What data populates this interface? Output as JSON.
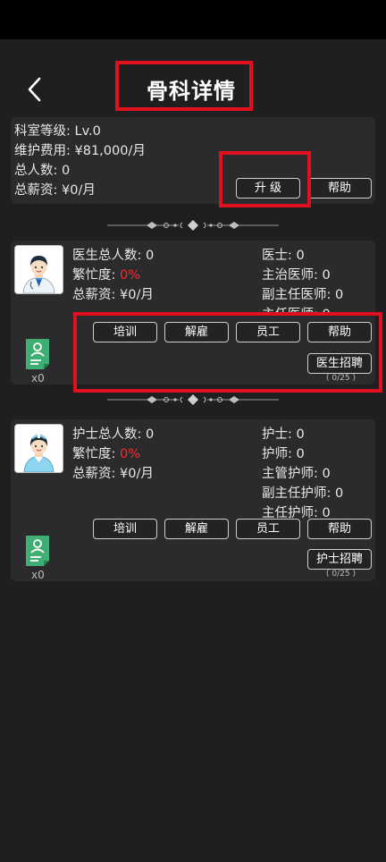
{
  "header": {
    "title": "骨科详情"
  },
  "summary": {
    "level": "科室等级: Lv.0",
    "maintenance": "维护费用: ¥81,000/月",
    "headcount": "总人数: 0",
    "salary": "总薪资: ¥0/月",
    "upgrade_label": "升 级",
    "help_label": "帮助"
  },
  "doctors": {
    "total": "医生总人数: 0",
    "busy_prefix": "繁忙度: ",
    "busy_value": "0%",
    "salary": "总薪资: ¥0/月",
    "ranks": [
      "医士: 0",
      "主治医师: 0",
      "副主任医师: 0",
      "主任医师: 0"
    ],
    "buttons": {
      "train": "培训",
      "fire": "解雇",
      "staff": "员工",
      "help": "帮助"
    },
    "recruit_label": "医生招聘",
    "capacity": "( 0/25 )",
    "count": "x0"
  },
  "nurses": {
    "total": "护士总人数: 0",
    "busy_prefix": "繁忙度: ",
    "busy_value": "0%",
    "salary": "总薪资: ¥0/月",
    "ranks": [
      "护士: 0",
      "护师: 0",
      "主管护师: 0",
      "副主任护师: 0",
      "主任护师: 0"
    ],
    "buttons": {
      "train": "培训",
      "fire": "解雇",
      "staff": "员工",
      "help": "帮助"
    },
    "recruit_label": "护士招聘",
    "capacity": "( 0/25 )",
    "count": "x0"
  },
  "colors": {
    "accent_red": "#ff2a2a",
    "highlight_box": "#e0101e",
    "resume_green": "#3fae72"
  }
}
